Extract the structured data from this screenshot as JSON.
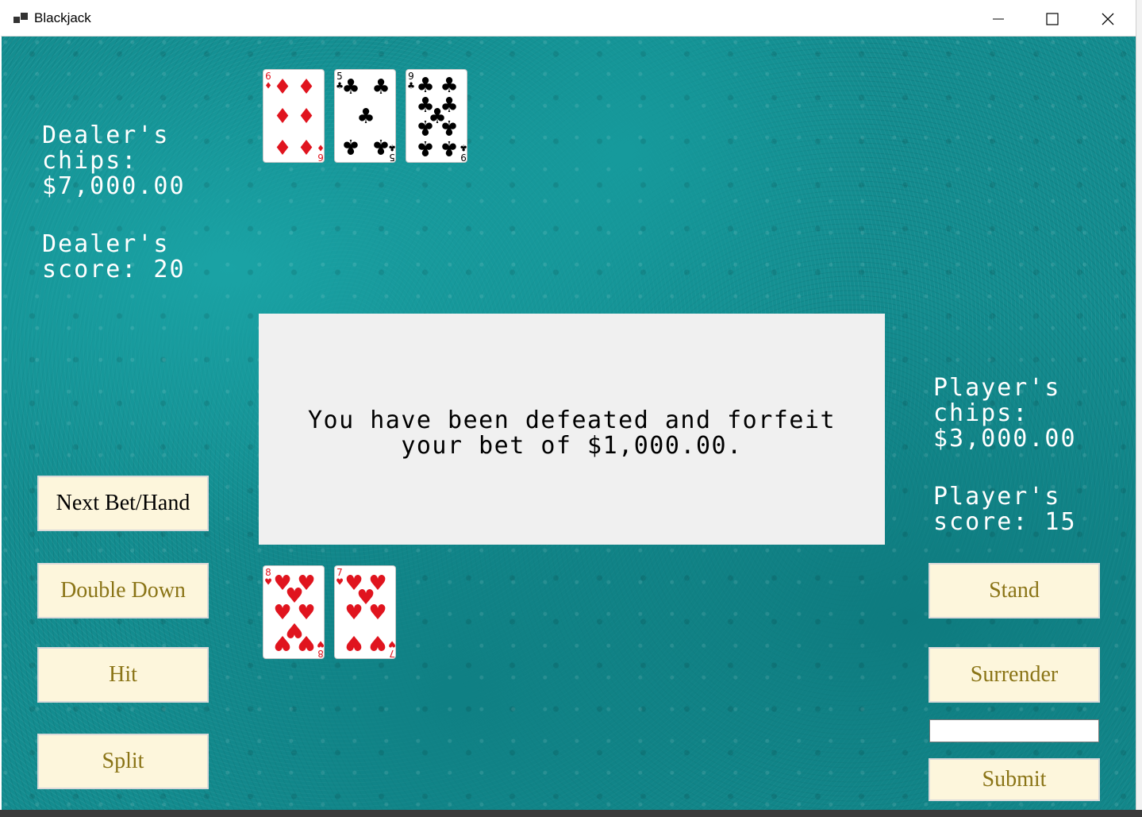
{
  "window": {
    "title": "Blackjack"
  },
  "dealer": {
    "chips_text": "Dealer's\nchips:\n$7,000.00",
    "score_text": "Dealer's\nscore: 20",
    "cards": [
      {
        "rank": "6",
        "suit": "diamonds"
      },
      {
        "rank": "5",
        "suit": "clubs"
      },
      {
        "rank": "9",
        "suit": "clubs"
      }
    ]
  },
  "player": {
    "chips_text": "Player's\nchips:\n$3,000.00",
    "score_text": "Player's\nscore: 15",
    "cards": [
      {
        "rank": "8",
        "suit": "hearts"
      },
      {
        "rank": "7",
        "suit": "hearts"
      }
    ]
  },
  "message": "You have been defeated and forfeit your bet of $1,000.00.",
  "buttons": {
    "next_bet_hand": "Next Bet/Hand",
    "double_down": "Double Down",
    "hit": "Hit",
    "split": "Split",
    "stand": "Stand",
    "surrender": "Surrender",
    "submit": "Submit"
  },
  "bet_input": {
    "value": ""
  },
  "colors": {
    "felt": "#138c8f",
    "button_bg": "#fdf6dc",
    "button_text_disabled": "#8a7416",
    "red_suit": "#e0141e",
    "black_suit": "#000000"
  }
}
